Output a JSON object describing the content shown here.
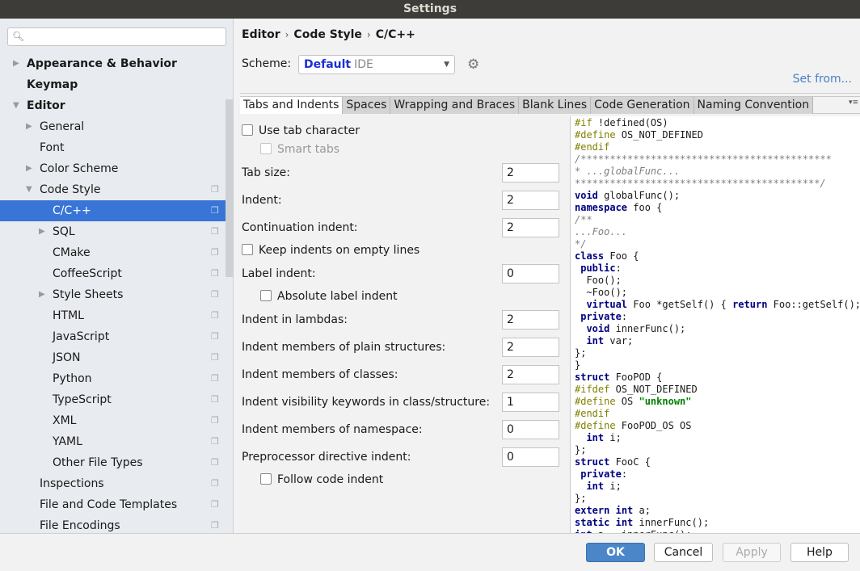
{
  "window": {
    "title": "Settings"
  },
  "sidebar": {
    "items": [
      {
        "label": "Appearance & Behavior",
        "level": 0,
        "arrow": "right",
        "bold": true
      },
      {
        "label": "Keymap",
        "level": 0,
        "arrow": "",
        "bold": true
      },
      {
        "label": "Editor",
        "level": 0,
        "arrow": "down",
        "bold": true
      },
      {
        "label": "General",
        "level": 1,
        "arrow": "right"
      },
      {
        "label": "Font",
        "level": 1,
        "arrow": ""
      },
      {
        "label": "Color Scheme",
        "level": 1,
        "arrow": "right"
      },
      {
        "label": "Code Style",
        "level": 1,
        "arrow": "down",
        "copy": true
      },
      {
        "label": "C/C++",
        "level": 2,
        "arrow": "",
        "copy": true,
        "selected": true
      },
      {
        "label": "SQL",
        "level": 2,
        "arrow": "right",
        "copy": true
      },
      {
        "label": "CMake",
        "level": 2,
        "arrow": "",
        "copy": true
      },
      {
        "label": "CoffeeScript",
        "level": 2,
        "arrow": "",
        "copy": true
      },
      {
        "label": "Style Sheets",
        "level": 2,
        "arrow": "right",
        "copy": true
      },
      {
        "label": "HTML",
        "level": 2,
        "arrow": "",
        "copy": true
      },
      {
        "label": "JavaScript",
        "level": 2,
        "arrow": "",
        "copy": true
      },
      {
        "label": "JSON",
        "level": 2,
        "arrow": "",
        "copy": true
      },
      {
        "label": "Python",
        "level": 2,
        "arrow": "",
        "copy": true
      },
      {
        "label": "TypeScript",
        "level": 2,
        "arrow": "",
        "copy": true
      },
      {
        "label": "XML",
        "level": 2,
        "arrow": "",
        "copy": true
      },
      {
        "label": "YAML",
        "level": 2,
        "arrow": "",
        "copy": true
      },
      {
        "label": "Other File Types",
        "level": 2,
        "arrow": "",
        "copy": true
      },
      {
        "label": "Inspections",
        "level": 1,
        "arrow": "",
        "copy": true
      },
      {
        "label": "File and Code Templates",
        "level": 1,
        "arrow": "",
        "copy": true
      },
      {
        "label": "File Encodings",
        "level": 1,
        "arrow": "",
        "copy": true
      }
    ]
  },
  "breadcrumb": [
    "Editor",
    "Code Style",
    "C/C++"
  ],
  "scheme": {
    "label": "Scheme:",
    "name": "Default",
    "type": "IDE"
  },
  "set_from": "Set from...",
  "tabs": [
    "Tabs and Indents",
    "Spaces",
    "Wrapping and Braces",
    "Blank Lines",
    "Code Generation",
    "Naming Convention"
  ],
  "options": [
    {
      "kind": "check",
      "label": "Use tab character",
      "checked": false
    },
    {
      "kind": "check",
      "label": "Smart tabs",
      "checked": false,
      "disabled": true,
      "indent": true
    },
    {
      "kind": "num",
      "label": "Tab size:",
      "value": "2"
    },
    {
      "kind": "num",
      "label": "Indent:",
      "value": "2"
    },
    {
      "kind": "num",
      "label": "Continuation indent:",
      "value": "2"
    },
    {
      "kind": "check",
      "label": "Keep indents on empty lines",
      "checked": false
    },
    {
      "kind": "num",
      "label": "Label indent:",
      "value": "0"
    },
    {
      "kind": "check",
      "label": "Absolute label indent",
      "checked": false,
      "indent": true
    },
    {
      "kind": "num",
      "label": "Indent in lambdas:",
      "value": "2"
    },
    {
      "kind": "num",
      "label": "Indent members of plain structures:",
      "value": "2"
    },
    {
      "kind": "num",
      "label": "Indent members of classes:",
      "value": "2"
    },
    {
      "kind": "num",
      "label": "Indent visibility keywords in class/structure:",
      "value": "1"
    },
    {
      "kind": "num",
      "label": "Indent members of namespace:",
      "value": "0"
    },
    {
      "kind": "num",
      "label": "Preprocessor directive indent:",
      "value": "0"
    },
    {
      "kind": "check",
      "label": "Follow code indent",
      "checked": false,
      "indent": true
    }
  ],
  "code_lines": [
    "#if !defined(OS)",
    "#define OS_NOT_DEFINED",
    "#endif",
    "/*******************************************",
    "* ...globalFunc...",
    "******************************************/",
    "void globalFunc();",
    "namespace foo {",
    "/**",
    "...Foo...",
    "*/",
    "class Foo {",
    " public:",
    "  Foo();",
    "  ~Foo();",
    "  virtual Foo *getSelf() { return Foo::getSelf(); }",
    " private:",
    "  void innerFunc();",
    "  int var;",
    "};",
    "}",
    "struct FooPOD {",
    "#ifdef OS_NOT_DEFINED",
    "#define OS \"unknown\"",
    "#endif",
    "#define FooPOD_OS OS",
    "  int i;",
    "};",
    "struct FooC {",
    " private:",
    "  int i;",
    "};",
    "extern int a;",
    "static int innerFunc();",
    "int a = innerFunc();"
  ],
  "buttons": {
    "ok": "OK",
    "cancel": "Cancel",
    "apply": "Apply",
    "help": "Help"
  },
  "colors": {
    "accent": "#3875d7",
    "keyword": "#000080",
    "preprocessor": "#808000",
    "comment": "#808080",
    "string": "#008000"
  }
}
